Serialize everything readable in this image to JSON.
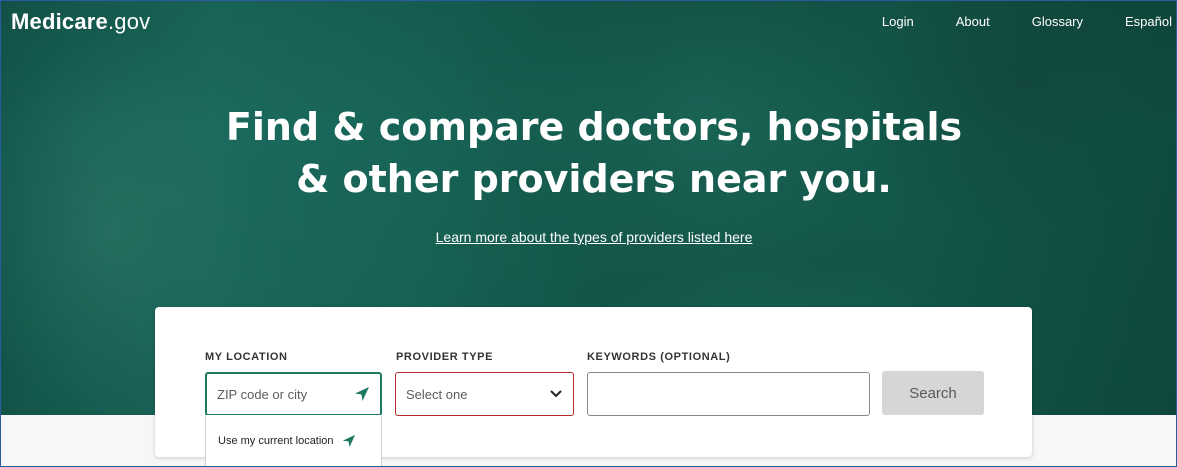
{
  "brand": {
    "name_bold": "Medicare",
    "name_suffix": ".gov"
  },
  "nav": [
    "Login",
    "About",
    "Glossary",
    "Español"
  ],
  "hero": {
    "headline_line1": "Find & compare doctors, hospitals",
    "headline_line2": "& other providers near you.",
    "learn_link": "Learn more about the types of providers listed here"
  },
  "search": {
    "location_label": "MY LOCATION",
    "location_placeholder": "ZIP code or city",
    "provider_label": "PROVIDER TYPE",
    "provider_value": "Select one",
    "keywords_label": "KEYWORDS (OPTIONAL)",
    "keywords_value": "",
    "search_button": "Search",
    "use_location": "Use my current location"
  },
  "colors": {
    "accent": "#1e7a62",
    "error": "#b22b2b",
    "hero": "#14584d"
  },
  "icons": {
    "location": "location-arrow-icon",
    "dropdown": "chevron-down-icon"
  }
}
